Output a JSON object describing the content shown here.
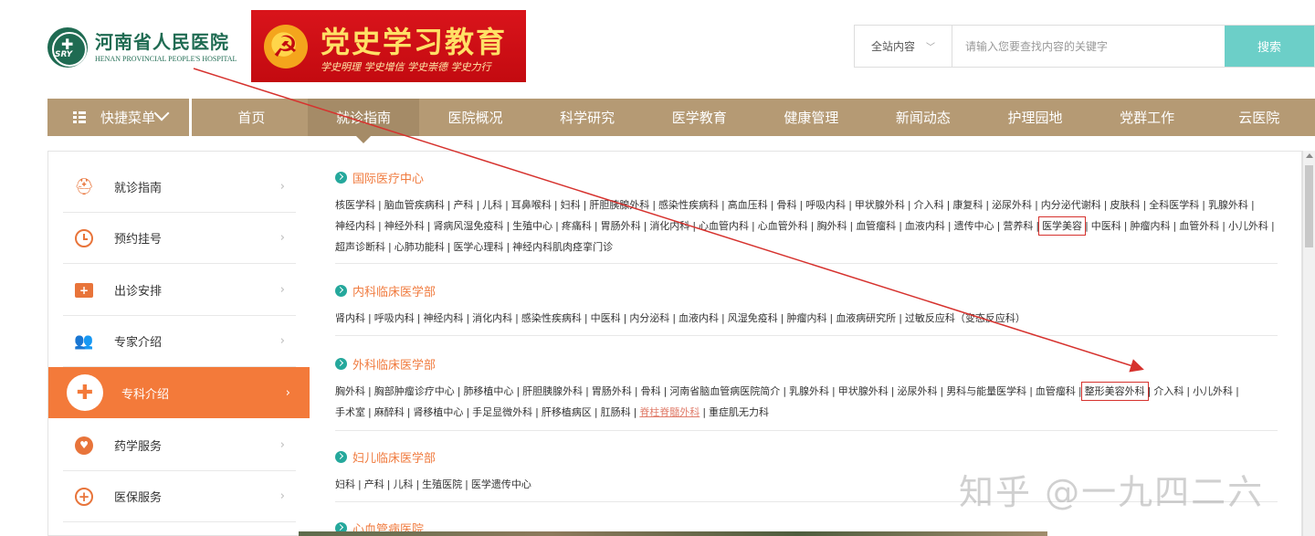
{
  "header": {
    "logo_cn": "河南省人民医院",
    "logo_en": "HENAN PROVINCIAL PEOPLE'S HOSPITAL",
    "logo_emblem": "SRY",
    "banner_title": "党史学习教育",
    "banner_sub": "学史明理 学史增信 学史崇德 学史力行",
    "search_scope": "全站内容",
    "search_placeholder": "请输入您要查找内容的关键字",
    "search_button": "搜索"
  },
  "nav": {
    "quick_menu": "快捷菜单",
    "items": [
      "首页",
      "就诊指南",
      "医院概况",
      "科学研究",
      "医学教育",
      "健康管理",
      "新闻动态",
      "护理园地",
      "党群工作",
      "云医院"
    ],
    "active_index": 1
  },
  "side_menu": [
    {
      "label": "就诊指南",
      "icon": "people-icon"
    },
    {
      "label": "预约挂号",
      "icon": "clock-icon"
    },
    {
      "label": "出诊安排",
      "icon": "medical-kit-icon"
    },
    {
      "label": "专家介绍",
      "icon": "group-icon"
    },
    {
      "label": "专科介绍",
      "icon": "plus-cross-icon",
      "active": true
    },
    {
      "label": "药学服务",
      "icon": "heart-icon"
    },
    {
      "label": "医保服务",
      "icon": "plus-circle-icon"
    }
  ],
  "sections": [
    {
      "title": "国际医疗中心",
      "links": [
        "核医学科",
        "脑血管疾病科",
        "产科",
        "儿科",
        "耳鼻喉科",
        "妇科",
        "肝胆胰腺外科",
        "感染性疾病科",
        "高血压科",
        "骨科",
        "呼吸内科",
        "甲状腺外科",
        "介入科",
        "康复科",
        "泌尿外科",
        "内分泌代谢科",
        "皮肤科",
        "全科医学科",
        "乳腺外科",
        "神经内科",
        "神经外科",
        "肾病风湿免疫科",
        "生殖中心",
        "疼痛科",
        "胃肠外科",
        "消化内科",
        "心血管内科",
        "心血管外科",
        "胸外科",
        "血管瘤科",
        "血液内科",
        "遗传中心",
        "营养科",
        "医学美容",
        "中医科",
        "肿瘤内科",
        "血管外科",
        "小儿外科",
        "超声诊断科",
        "心肺功能科",
        "医学心理科",
        "神经内科肌肉痉挛门诊"
      ]
    },
    {
      "title": "内科临床医学部",
      "links": [
        "肾内科",
        "呼吸内科",
        "神经内科",
        "消化内科",
        "感染性疾病科",
        "中医科",
        "内分泌科",
        "血液内科",
        "风湿免疫科",
        "肿瘤内科",
        "血液病研究所",
        "过敏反应科（变态反应科）"
      ]
    },
    {
      "title": "外科临床医学部",
      "links": [
        "胸外科",
        "胸部肿瘤诊疗中心",
        "肺移植中心",
        "肝胆胰腺外科",
        "胃肠外科",
        "骨科",
        "河南省脑血管病医院简介",
        "乳腺外科",
        "甲状腺外科",
        "泌尿外科",
        "男科与能量医学科",
        "血管瘤科",
        "整形美容外科",
        "介入科",
        "小儿外科",
        "手术室",
        "麻醉科",
        "肾移植中心",
        "手足显微外科",
        "肝移植病区",
        "肛肠科",
        "脊柱脊髓外科",
        "重症肌无力科"
      ]
    },
    {
      "title": "妇儿临床医学部",
      "links": [
        "妇科",
        "产科",
        "儿科",
        "生殖医院",
        "医学遗传中心"
      ]
    },
    {
      "title": "心血管病医院",
      "links": []
    }
  ],
  "highlights": {
    "boxed": [
      "医学美容",
      "整形美容外科"
    ],
    "underlined": [
      "脊柱脊髓外科"
    ]
  },
  "watermark": "知乎 @一九四二六",
  "annotation_color": "#d6322e"
}
